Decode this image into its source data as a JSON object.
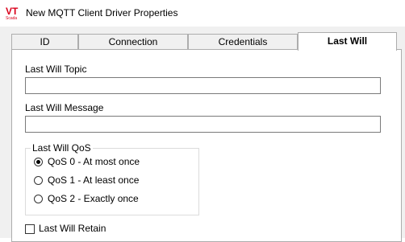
{
  "window": {
    "title": "New MQTT Client Driver Properties",
    "logo_text": "VT",
    "logo_subtext": "Scada",
    "logo_color": "#d9001b"
  },
  "tabs": [
    {
      "label": "ID",
      "active": false
    },
    {
      "label": "Connection",
      "active": false
    },
    {
      "label": "Credentials",
      "active": false
    },
    {
      "label": "Last Will",
      "active": true
    }
  ],
  "last_will": {
    "topic_label": "Last Will Topic",
    "topic_value": "",
    "message_label": "Last Will Message",
    "message_value": "",
    "qos_label": "Last Will QoS",
    "qos_options": [
      {
        "label": "QoS 0 - At most once",
        "selected": true
      },
      {
        "label": "QoS 1 - At least once",
        "selected": false
      },
      {
        "label": "QoS 2 - Exactly once",
        "selected": false
      }
    ],
    "retain_label": "Last Will Retain",
    "retain_checked": false
  }
}
